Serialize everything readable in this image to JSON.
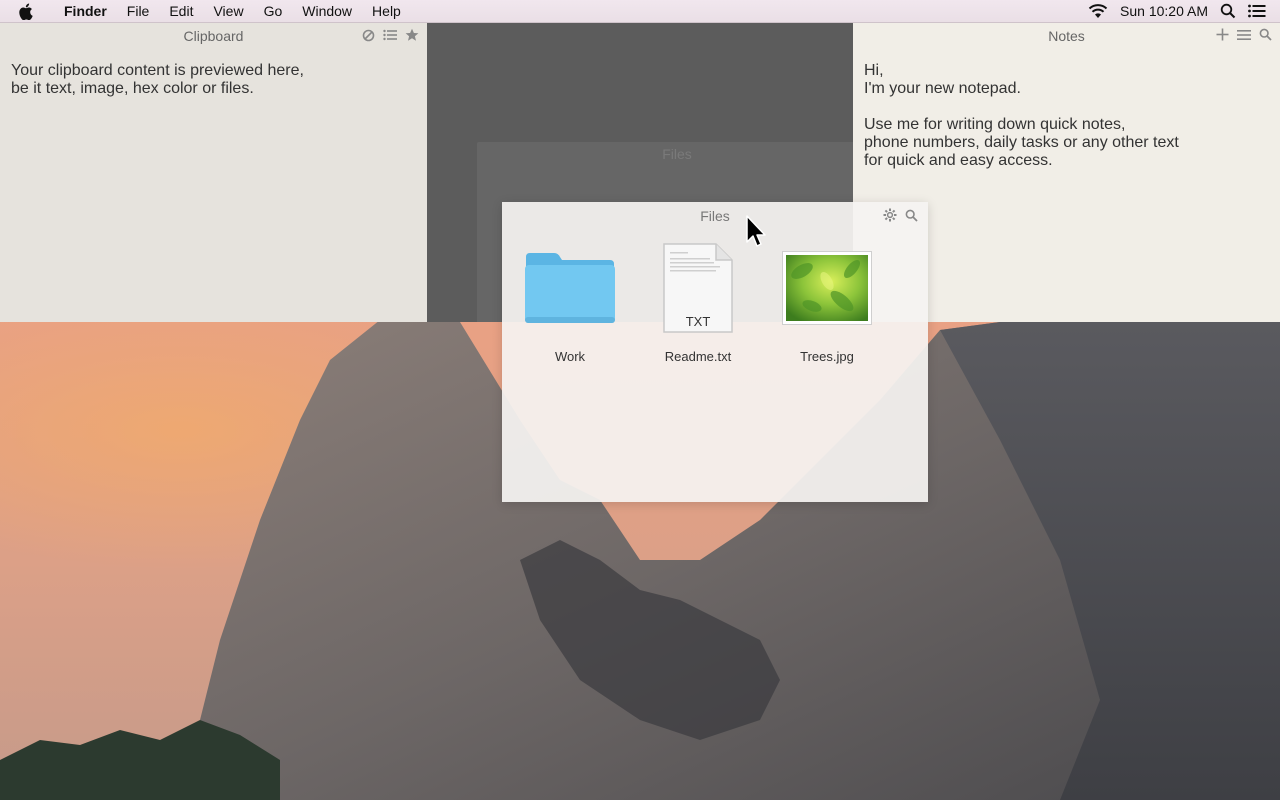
{
  "menubar": {
    "app_name": "Finder",
    "items": [
      "File",
      "Edit",
      "View",
      "Go",
      "Window",
      "Help"
    ],
    "clock": "Sun 10:20 AM"
  },
  "clipboard": {
    "title": "Clipboard",
    "body": "Your clipboard content is previewed here,\nbe it text, image, hex color or files."
  },
  "notes": {
    "title": "Notes",
    "body": "Hi,\nI'm your new notepad.\n\nUse me for writing down quick notes,\nphone numbers, daily tasks or any other text\nfor quick and easy access."
  },
  "files": {
    "title": "Files",
    "ghost_title": "Files",
    "items": [
      {
        "name": "Work",
        "type": "folder"
      },
      {
        "name": "Readme.txt",
        "type": "text",
        "badge": "TXT"
      },
      {
        "name": "Trees.jpg",
        "type": "image"
      }
    ]
  },
  "colors": {
    "folder_blue": "#6cc4ee",
    "panel_light": "#e6e3dd",
    "notes_bg": "#f1eee7"
  }
}
